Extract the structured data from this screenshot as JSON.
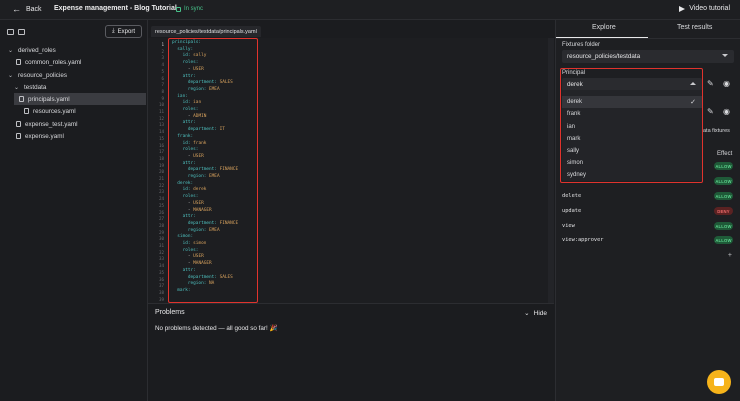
{
  "topbar": {
    "back_label": "Back",
    "title": "Expense management - Blog Tutorial",
    "sync_label": "In sync",
    "video_label": "Video tutorial"
  },
  "sidebar": {
    "export_label": "Export",
    "tree": [
      {
        "label": "derived_roles",
        "type": "folder"
      },
      {
        "label": "common_roles.yaml",
        "type": "file"
      },
      {
        "label": "resource_policies",
        "type": "folder"
      },
      {
        "label": "testdata",
        "type": "folder"
      },
      {
        "label": "principals.yaml",
        "type": "file",
        "selected": true
      },
      {
        "label": "resources.yaml",
        "type": "file"
      },
      {
        "label": "expense_test.yaml",
        "type": "file"
      },
      {
        "label": "expense.yaml",
        "type": "file"
      }
    ]
  },
  "editor": {
    "tab_label": "resource_policies/testdata/principals.yaml",
    "line_numbers": [
      "1",
      "2",
      "3",
      "4",
      "5",
      "6",
      "7",
      "8",
      "9",
      "10",
      "11",
      "12",
      "13",
      "14",
      "15",
      "16",
      "17",
      "18",
      "19",
      "20",
      "21",
      "22",
      "23",
      "24",
      "25",
      "26",
      "27",
      "28",
      "29",
      "30",
      "31",
      "32",
      "33",
      "34",
      "35",
      "36",
      "37",
      "38",
      "39"
    ],
    "lines": [
      {
        "k": "principals:",
        "v": ""
      },
      {
        "k": "  sally:",
        "v": ""
      },
      {
        "k": "    id: ",
        "v": "sally"
      },
      {
        "k": "    roles:",
        "v": ""
      },
      {
        "k": "      - ",
        "v": "USER"
      },
      {
        "k": "    attr:",
        "v": ""
      },
      {
        "k": "      department: ",
        "v": "SALES"
      },
      {
        "k": "      region: ",
        "v": "EMEA"
      },
      {
        "k": "  ian:",
        "v": ""
      },
      {
        "k": "    id: ",
        "v": "ian"
      },
      {
        "k": "    roles:",
        "v": ""
      },
      {
        "k": "      - ",
        "v": "ADMIN"
      },
      {
        "k": "    attr:",
        "v": ""
      },
      {
        "k": "      department: ",
        "v": "IT"
      },
      {
        "k": "  frank:",
        "v": ""
      },
      {
        "k": "    id: ",
        "v": "frank"
      },
      {
        "k": "    roles:",
        "v": ""
      },
      {
        "k": "      - ",
        "v": "USER"
      },
      {
        "k": "    attr:",
        "v": ""
      },
      {
        "k": "      department: ",
        "v": "FINANCE"
      },
      {
        "k": "      region: ",
        "v": "EMEA"
      },
      {
        "k": "  derek:",
        "v": ""
      },
      {
        "k": "    id: ",
        "v": "derek"
      },
      {
        "k": "    roles:",
        "v": ""
      },
      {
        "k": "      - ",
        "v": "USER"
      },
      {
        "k": "      - ",
        "v": "MANAGER"
      },
      {
        "k": "    attr:",
        "v": ""
      },
      {
        "k": "      department: ",
        "v": "FINANCE"
      },
      {
        "k": "      region: ",
        "v": "EMEA"
      },
      {
        "k": "  simon:",
        "v": ""
      },
      {
        "k": "    id: ",
        "v": "simon"
      },
      {
        "k": "    roles:",
        "v": ""
      },
      {
        "k": "      - ",
        "v": "USER"
      },
      {
        "k": "      - ",
        "v": "MANAGER"
      },
      {
        "k": "    attr:",
        "v": ""
      },
      {
        "k": "      department: ",
        "v": "SALES"
      },
      {
        "k": "      region: ",
        "v": "NA"
      },
      {
        "k": "  mark:",
        "v": ""
      },
      {
        "k": "",
        "v": ""
      }
    ]
  },
  "problems": {
    "title": "Problems",
    "hide_label": "Hide",
    "message": "No problems detected — all good so far! 🎉"
  },
  "right_panel": {
    "tabs": [
      "Explore",
      "Test results"
    ],
    "fixtures_label": "Fixtures folder",
    "fixtures_value": "resource_policies/testdata",
    "principal_label": "Principal",
    "principal_value": "derek",
    "principal_options": [
      "derek",
      "frank",
      "ian",
      "mark",
      "sally",
      "simon",
      "sydney"
    ],
    "partial_text": "ata fixtures",
    "effect_header": "Effect",
    "actions": [
      {
        "name": "",
        "effect": "ALLOW"
      },
      {
        "name": "",
        "effect": "ALLOW"
      },
      {
        "name": "delete",
        "effect": "ALLOW"
      },
      {
        "name": "update",
        "effect": "DENY"
      },
      {
        "name": "view",
        "effect": "ALLOW"
      },
      {
        "name": "view:approver",
        "effect": "ALLOW"
      }
    ]
  },
  "colors": {
    "accent_red": "#e0332d",
    "allow_green": "#5ed58f",
    "deny_red": "#ef6b6b",
    "chat_yellow": "#f6b31a",
    "yaml_key": "#4fc2c0",
    "yaml_value": "#d9a35e"
  }
}
